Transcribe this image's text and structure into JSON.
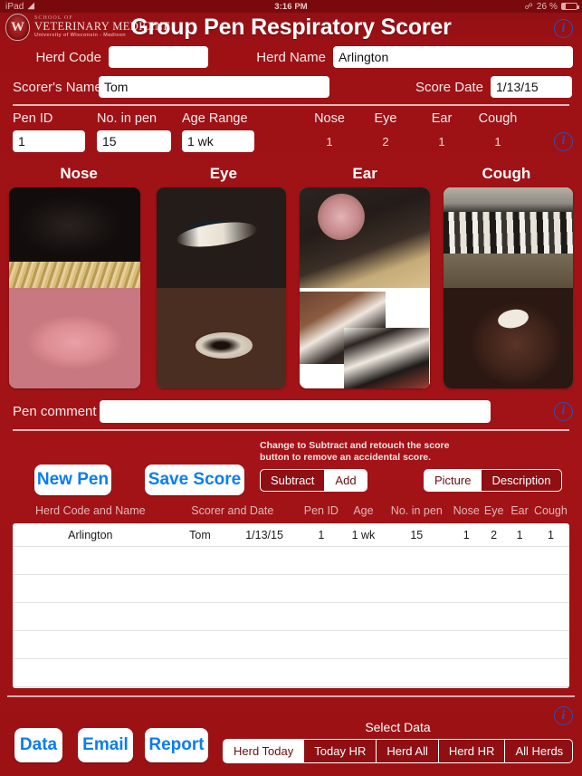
{
  "statusbar": {
    "device": "iPad",
    "wifi_icon": "wifi-icon",
    "time": "3:16 PM",
    "bluetooth_icon": "bluetooth-icon",
    "battery_percent": "26 %"
  },
  "titlebar": {
    "logo_line1": "SCHOOL OF",
    "logo_line2": "VETERINARY MEDICINE",
    "logo_line3": "University of Wisconsin - Madison",
    "crest_letter": "W",
    "app_title": "Group Pen Respiratory Scorer",
    "info_icon": "info-icon"
  },
  "form": {
    "herd_code_label": "Herd Code",
    "herd_code_value": "",
    "herd_code_placeholder": "",
    "herd_name_label": "Herd Name",
    "herd_name_value": "Arlington",
    "scorer_name_label": "Scorer's Name",
    "scorer_name_value": "Tom",
    "score_date_label": "Score Date",
    "score_date_value": "1/13/15"
  },
  "pen": {
    "headers": [
      "Pen ID",
      "No. in pen",
      "Age Range",
      "Nose",
      "Eye",
      "Ear",
      "Cough"
    ],
    "pen_id_value": "1",
    "no_in_pen_value": "15",
    "age_range_value": "1 wk",
    "scores": {
      "nose": "1",
      "eye": "2",
      "ear": "1",
      "cough": "1"
    },
    "info_icon": "info-icon"
  },
  "categories": [
    {
      "label": "Nose",
      "name": "nose-panel"
    },
    {
      "label": "Eye",
      "name": "eye-panel"
    },
    {
      "label": "Ear",
      "name": "ear-panel"
    },
    {
      "label": "Cough",
      "name": "cough-panel"
    }
  ],
  "comment": {
    "label": "Pen comment",
    "value": "",
    "placeholder": "",
    "info_icon": "info-icon"
  },
  "actions": {
    "new_pen": "New Pen",
    "save_score": "Save Score",
    "hint_line1": "Change to Subtract and retouch the score",
    "hint_line2": "button to remove an accidental score.",
    "mode_options": [
      {
        "label": "Subtract",
        "selected": false
      },
      {
        "label": "Add",
        "selected": true
      }
    ],
    "view_options": [
      {
        "label": "Picture",
        "selected": true
      },
      {
        "label": "Description",
        "selected": false
      }
    ]
  },
  "table": {
    "headers": [
      "Herd Code and Name",
      "Scorer and Date",
      "Pen ID",
      "Age",
      "No. in pen",
      "Nose",
      "Eye",
      "Ear",
      "Cough"
    ],
    "rows": [
      {
        "herd_code": "",
        "herd_name": "Arlington",
        "scorer": "Tom",
        "date": "1/13/15",
        "pen_id": "1",
        "age": "1 wk",
        "no_in_pen": "15",
        "nose": "1",
        "eye": "2",
        "ear": "1",
        "cough": "1"
      }
    ],
    "empty_row_count": 5
  },
  "footer": {
    "info_icon": "info-icon",
    "buttons": [
      {
        "label": "Data"
      },
      {
        "label": "Email"
      },
      {
        "label": "Report"
      }
    ],
    "select_data_label": "Select Data",
    "select_data_options": [
      {
        "label": "Herd Today",
        "selected": true
      },
      {
        "label": "Today HR",
        "selected": false
      },
      {
        "label": "Herd All",
        "selected": false
      },
      {
        "label": "Herd HR",
        "selected": false
      },
      {
        "label": "All Herds",
        "selected": false
      }
    ]
  },
  "colors": {
    "brand_red": "#9d1115",
    "dark_red": "#780a0d",
    "accent_blue": "#0a7cf3",
    "info_blue": "#2f4fae",
    "white": "#ffffff"
  }
}
